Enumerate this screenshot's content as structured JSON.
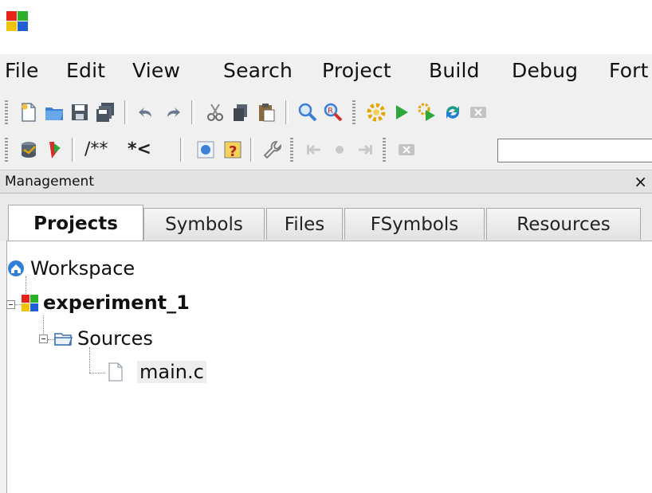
{
  "menu": [
    "File",
    "Edit",
    "View",
    "Search",
    "Project",
    "Build",
    "Debug",
    "Fort"
  ],
  "toolbar2_text": [
    "/**",
    "*<"
  ],
  "panel": {
    "title": "Management",
    "close": "×"
  },
  "tabs": [
    {
      "label": "Projects",
      "active": true
    },
    {
      "label": "Symbols"
    },
    {
      "label": "Files"
    },
    {
      "label": "FSymbols"
    },
    {
      "label": "Resources"
    }
  ],
  "tree": {
    "workspace": "Workspace",
    "project": "experiment_1",
    "folder": "Sources",
    "file": "main.c"
  }
}
